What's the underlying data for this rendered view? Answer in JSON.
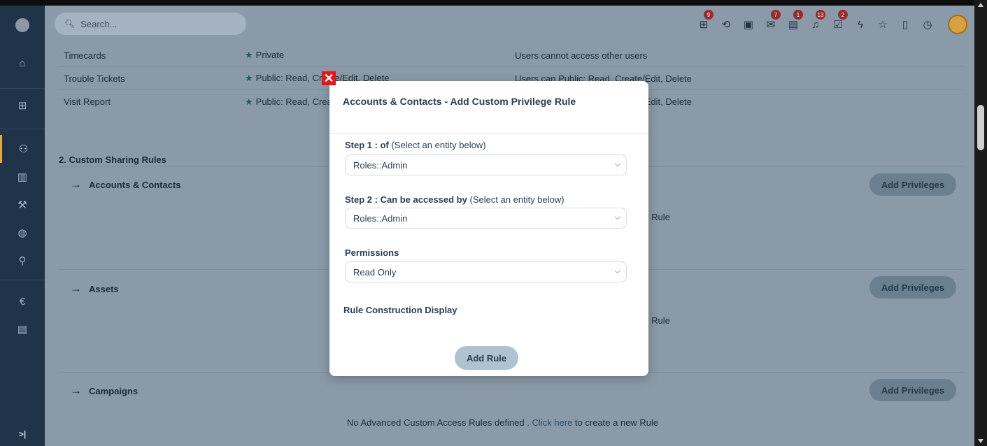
{
  "search": {
    "placeholder": "Search..."
  },
  "header_icons": [
    {
      "name": "sitemap-icon",
      "glyph": "⊞",
      "badge": "9"
    },
    {
      "name": "history-icon",
      "glyph": "⟲",
      "badge": ""
    },
    {
      "name": "calendar-icon",
      "glyph": "▣",
      "badge": ""
    },
    {
      "name": "mail-icon",
      "glyph": "✉",
      "badge": "7"
    },
    {
      "name": "chat-icon",
      "glyph": "▤",
      "badge": "1"
    },
    {
      "name": "bell-icon",
      "glyph": "♫",
      "badge": "13"
    },
    {
      "name": "tasks-icon",
      "glyph": "☑",
      "badge": "2"
    },
    {
      "name": "bolt-icon",
      "glyph": "ϟ",
      "badge": ""
    },
    {
      "name": "star-icon",
      "glyph": "☆",
      "badge": ""
    },
    {
      "name": "document-icon",
      "glyph": "▯",
      "badge": ""
    },
    {
      "name": "timer-icon",
      "glyph": "◷",
      "badge": ""
    }
  ],
  "privilege_rows": [
    {
      "module": "Timecards",
      "access": "Private",
      "description": "Users cannot access other users"
    },
    {
      "module": "Trouble Tickets",
      "access": "Public: Read, Create/Edit, Delete",
      "description": "Users can Public: Read, Create/Edit, Delete"
    },
    {
      "module": "Visit Report",
      "access": "Public: Read, Create/Edit, Delete",
      "description": "Users can Public: Read, Create/Edit, Delete"
    }
  ],
  "custom_sharing": {
    "title": "2. Custom Sharing Rules",
    "add_privileges_label": "Add Privileges",
    "modules": [
      {
        "name": "Accounts & Contacts"
      },
      {
        "name": "Assets"
      },
      {
        "name": "Campaigns"
      }
    ],
    "no_rules_prefix": "No Advanced Custom Access Rules defined .",
    "click_here": "Click here",
    "no_rules_suffix": "to create a new Rule",
    "partial_rule_text": "v Rule"
  },
  "modal": {
    "title": "Accounts & Contacts - Add Custom Privilege Rule",
    "step1_bold": "Step 1 : of",
    "step1_hint": "(Select an entity below)",
    "step1_value": "Roles::Admin",
    "step2_bold": "Step 2 : Can be accessed by",
    "step2_hint": "(Select an entity below)",
    "step2_value": "Roles::Admin",
    "permissions_label": "Permissions",
    "permissions_value": "Read Only",
    "rule_display_label": "Rule Construction Display",
    "add_rule_label": "Add Rule"
  }
}
